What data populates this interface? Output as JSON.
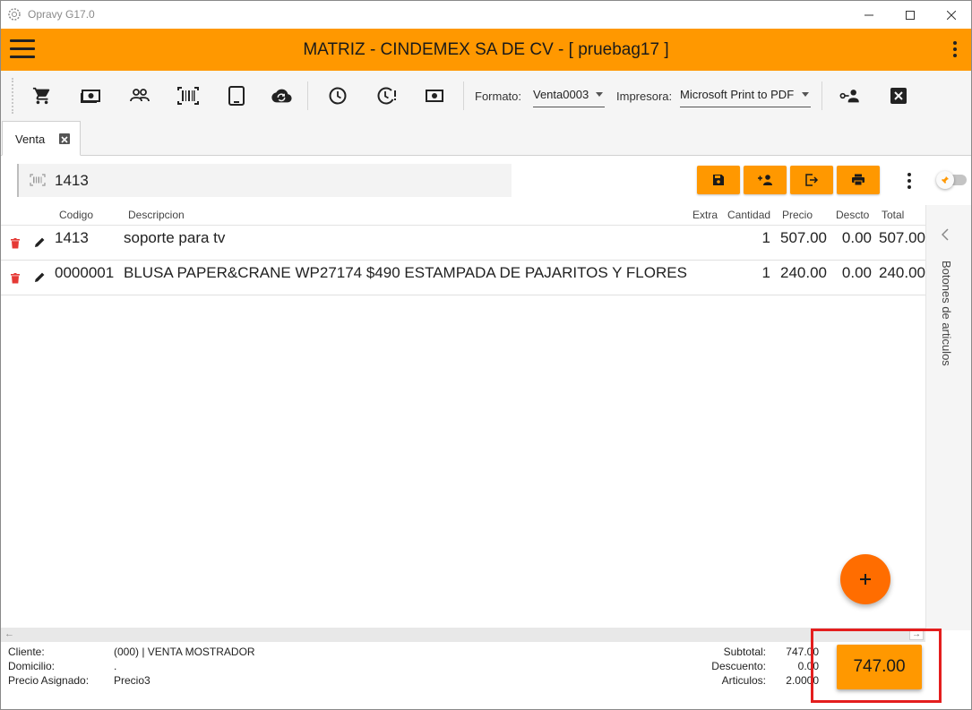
{
  "window": {
    "title": "Opravy G17.0"
  },
  "header": {
    "title": "MATRIZ - CINDEMEX SA DE CV - [ pruebag17 ]"
  },
  "toolbar": {
    "icons": [
      "cart-icon",
      "cash-icon",
      "customers-icon",
      "barcode-icon",
      "tablet-icon",
      "cloud-sync-icon",
      "clock-icon",
      "clock-alert-icon",
      "money-icon",
      "key-user-icon",
      "close-box-icon"
    ],
    "formato_label": "Formato:",
    "formato_value": "Venta0003",
    "impresora_label": "Impresora:",
    "impresora_value": "Microsoft Print to PDF"
  },
  "tabs": [
    {
      "label": "Venta",
      "active": true
    }
  ],
  "search": {
    "value": "1413"
  },
  "table": {
    "headers": {
      "codigo": "Codigo",
      "descripcion": "Descripcion",
      "extra": "Extra",
      "cantidad": "Cantidad",
      "precio": "Precio",
      "descto": "Descto",
      "total": "Total"
    },
    "rows": [
      {
        "codigo": "1413",
        "descripcion": "soporte para tv",
        "extra": "",
        "cantidad": "1",
        "precio": "507.00",
        "descto": "0.00",
        "total": "507.00"
      },
      {
        "codigo": "0000001",
        "descripcion": "BLUSA PAPER&CRANE WP27174 $490 ESTAMPADA DE PAJARITOS Y FLORES",
        "extra": "",
        "cantidad": "1",
        "precio": "240.00",
        "descto": "0.00",
        "total": "240.00"
      }
    ]
  },
  "side_panel": {
    "label": "Botones de articulos"
  },
  "footer": {
    "cliente_label": "Cliente:",
    "cliente_value": "(000) | VENTA MOSTRADOR",
    "domicilio_label": "Domicilio:",
    "domicilio_value": ".",
    "precio_label": "Precio Asignado:",
    "precio_value": "Precio3",
    "subtotal_label": "Subtotal:",
    "subtotal_value": "747.00",
    "descuento_label": "Descuento:",
    "descuento_value": "0.00",
    "articulos_label": "Articulos:",
    "articulos_value": "2.0000",
    "total": "747.00"
  },
  "colors": {
    "accent": "#ff9800",
    "fab": "#ff6d00",
    "delete": "#e53935",
    "highlight": "#e41e1e"
  }
}
